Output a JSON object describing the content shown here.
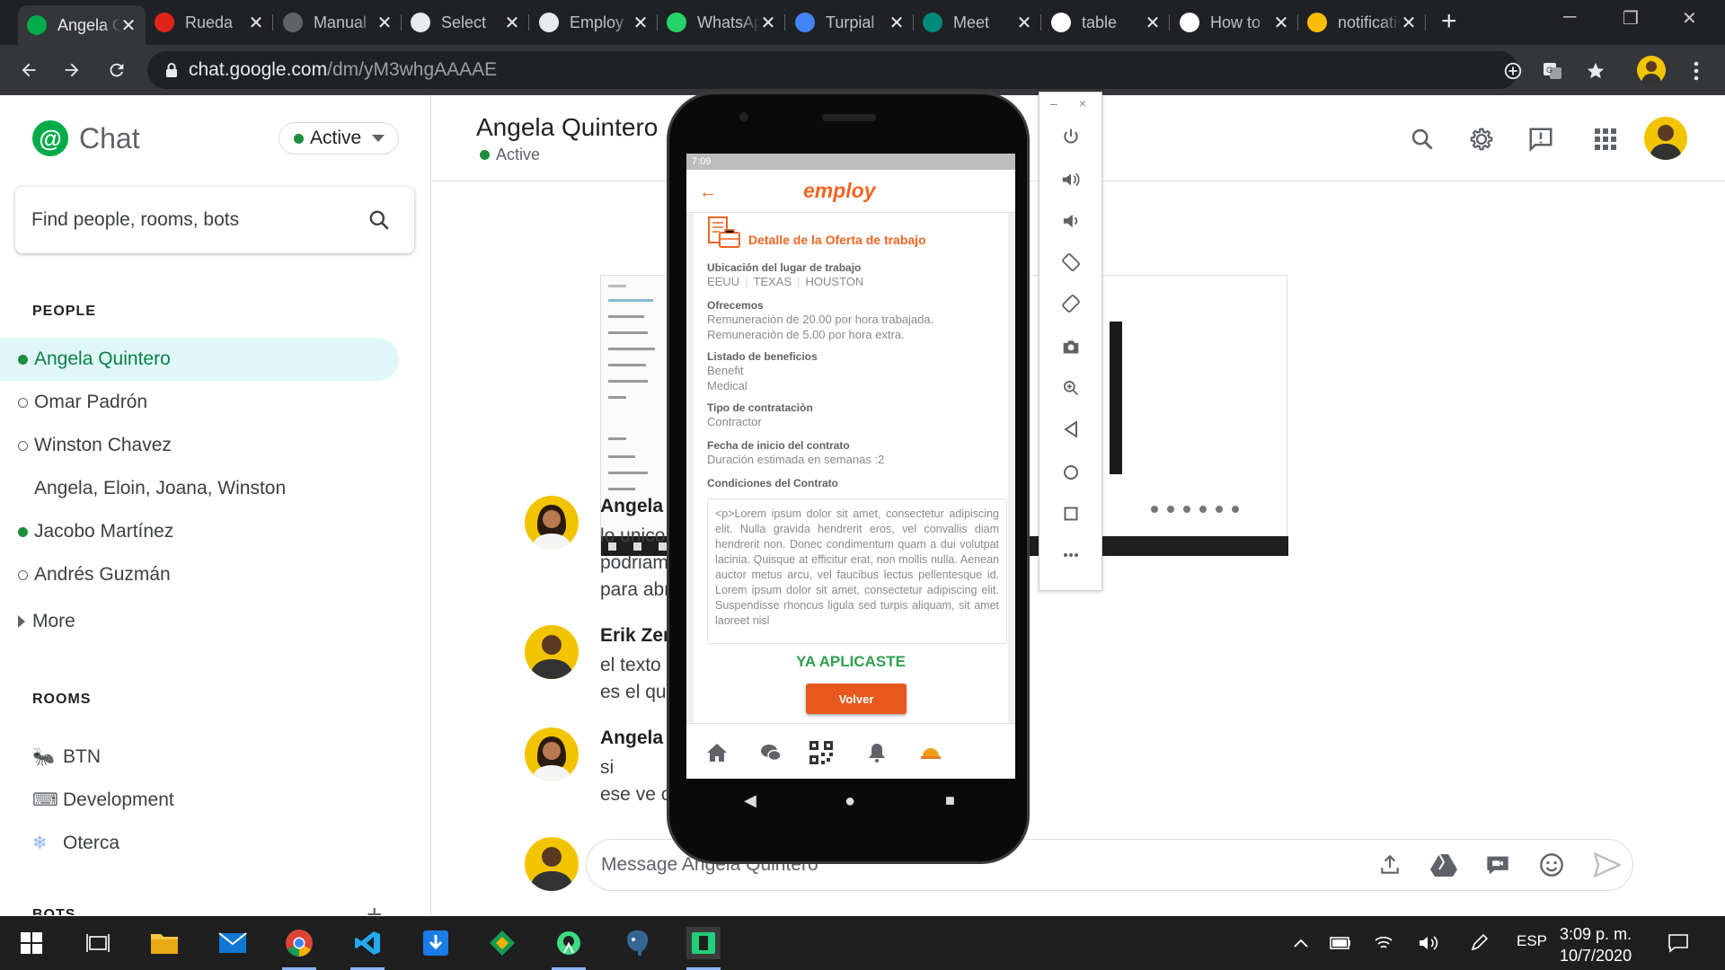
{
  "browser": {
    "tabs": [
      {
        "title": "Angela Quintero - Chat",
        "favicon": "chat-icon",
        "color": "#00ac47"
      },
      {
        "title": "Rueda",
        "favicon": "adobe-icon",
        "color": "#e1251b"
      },
      {
        "title": "Manual",
        "favicon": "globe-icon",
        "color": "#5f6368"
      },
      {
        "title": "Select",
        "favicon": "globe-icon",
        "color": "#e8eaed"
      },
      {
        "title": "Employ",
        "favicon": "globe-icon",
        "color": "#e8eaed"
      },
      {
        "title": "WhatsApp",
        "favicon": "whatsapp-icon",
        "color": "#25d366"
      },
      {
        "title": "Turpial",
        "favicon": "calendar-icon",
        "color": "#4285f4"
      },
      {
        "title": "Meet",
        "favicon": "meet-icon",
        "color": "#00897b"
      },
      {
        "title": "table",
        "favicon": "google-icon",
        "color": "#ffffff"
      },
      {
        "title": "How to",
        "favicon": "wordpress-icon",
        "color": "#ffffff"
      },
      {
        "title": "notifications",
        "favicon": "drive-icon",
        "color": "#fbbc04"
      }
    ],
    "url_host": "chat.google.com",
    "url_path": "/dm/yM3whgAAAAE"
  },
  "chat": {
    "brand": "Chat",
    "status": "Active",
    "search_placeholder": "Find people, rooms, bots",
    "people_heading": "PEOPLE",
    "people": [
      {
        "name": "Angela Quintero",
        "presence": "active"
      },
      {
        "name": "Omar Padrón",
        "presence": "away"
      },
      {
        "name": "Winston Chavez",
        "presence": "away"
      },
      {
        "name": "Angela, Eloin, Joana, Winston",
        "presence": "none"
      },
      {
        "name": "Jacobo Martínez",
        "presence": "active"
      },
      {
        "name": "Andrés Guzmán",
        "presence": "away"
      }
    ],
    "more": "More",
    "rooms_heading": "ROOMS",
    "rooms": [
      {
        "name": "BTN",
        "icon": "ant-icon"
      },
      {
        "name": "Development",
        "icon": "keyboard-icon"
      },
      {
        "name": "Oterca",
        "icon": "snowflake-icon"
      }
    ],
    "bots_heading": "BOTS",
    "conversation": {
      "title": "Angela Quintero",
      "status": "Active"
    },
    "messages": [
      {
        "from": "Angela",
        "lines": [
          "lo unico",
          "podriam",
          "para abr"
        ]
      },
      {
        "from": "Erik Zer",
        "lines": [
          "el texto",
          "es el qu"
        ]
      },
      {
        "from": "Angela",
        "lines": [
          "si",
          "ese ve c"
        ]
      }
    ],
    "compose_placeholder": "Message Angela Quintero"
  },
  "phone": {
    "time": "7:09",
    "app_logo": "employ",
    "job_title": "Detalle de la Oferta de trabajo",
    "location_label": "Ubicación del lugar de trabajo",
    "location": [
      "EEUU",
      "TEXAS",
      "HOUSTON"
    ],
    "offer_label": "Ofrecemos",
    "offer_lines": [
      "Remuneraciòn de 20.00  por hora trabajada.",
      "Remuneraciòn de 5.00  por hora extra."
    ],
    "benefits_label": "Listado de beneficios",
    "benefits": [
      "Benefit",
      "Medical"
    ],
    "contract_type_label": "Tipo de contrataciòn",
    "contract_type": "Contractor",
    "start_label": "Fecha de inicio del contrato",
    "duration": "Duración estimada en semanas :2",
    "conditions_label": "Condiciones del Contrato",
    "conditions_text": "<p>Lorem ipsum dolor sit amet, consectetur adipiscing elit. Nulla gravida hendrerit eros, vel convallis diam hendrerit non. Donec condimentum quam a dui volutpat lacinia. Quisque at efficitur erat, non mollis nulla. Aenean auctor metus arcu, vel faucibus lectus pellentesque id. Lorem ipsum dolor sit amet, consectetur adipiscing elit. Suspendisse rhoncus ligula sed turpis aliquam, sit amet laoreet nisl",
    "applied_text": "YA APLICASTE",
    "back_button": "Volver"
  },
  "taskbar": {
    "language": "ESP",
    "time": "3:09 p. m.",
    "date": "10/7/2020"
  },
  "colors": {
    "accent": "#f26522",
    "chat_green": "#00ac47",
    "applied_green": "#2e9e4f"
  }
}
